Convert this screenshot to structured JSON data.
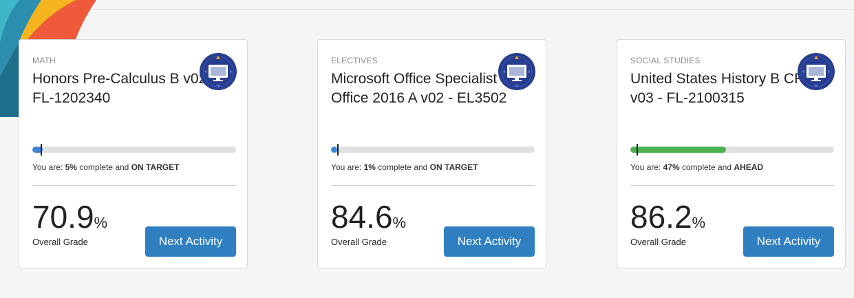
{
  "colors": {
    "accent": "#2f7fc1",
    "progress_blue": "#3c86d8",
    "progress_green": "#4cb050",
    "track": "#e0e0e0",
    "icon_bg": "#273d8f"
  },
  "courses": [
    {
      "subject": "MATH",
      "title": "Honors Pre-Calculus B v02 - FL-1202340",
      "icon": "computer-screen-icon",
      "progress": 5,
      "target": 4,
      "status_prefix": "You are: ",
      "status_percent": "5%",
      "status_mid": " complete and ",
      "status_word": "ON TARGET",
      "grade": "70.9",
      "grade_suffix": "%",
      "grade_label": "Overall Grade",
      "button": "Next Activity"
    },
    {
      "subject": "ELECTIVES",
      "title": "Microsoft Office Specialist - Office 2016 A v02 - EL3502",
      "icon": "computer-screen-icon",
      "progress": 1,
      "target": 3,
      "status_prefix": "You are: ",
      "status_percent": "1%",
      "status_mid": " complete and ",
      "status_word": "ON TARGET",
      "grade": "84.6",
      "grade_suffix": "%",
      "grade_label": "Overall Grade",
      "button": "Next Activity"
    },
    {
      "subject": "SOCIAL STUDIES",
      "title": "United States History B CR v03 - FL-2100315",
      "icon": "computer-screen-icon",
      "progress": 47,
      "target": 3,
      "status_prefix": "You are: ",
      "status_percent": "47%",
      "status_mid": " complete and ",
      "status_word": "AHEAD",
      "grade": "86.2",
      "grade_suffix": "%",
      "grade_label": "Overall Grade",
      "button": "Next Activity"
    }
  ]
}
